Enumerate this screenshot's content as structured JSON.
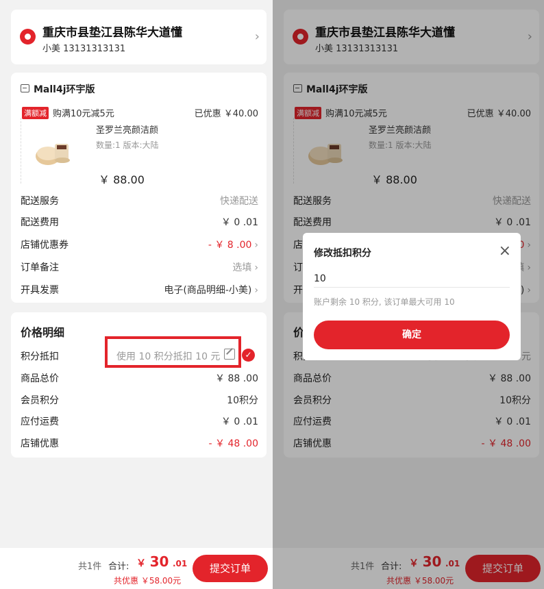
{
  "address": {
    "title": "重庆市县垫江县陈华大道懂",
    "contact": "小美 13131313131"
  },
  "shop": {
    "name": "Mall4j环宇版",
    "promo_tag": "满额减",
    "promo_text": "购满10元减5元",
    "promo_saved": "已优惠 ￥40.00",
    "product": {
      "name": "圣罗兰亮颜洁颜",
      "spec": "数量:1   版本:大陆",
      "price": "￥ 88.00"
    },
    "rows": [
      {
        "label": "配送服务",
        "value": "快递配送"
      },
      {
        "label": "配送费用",
        "value": "￥ 0 .01"
      },
      {
        "label": "店铺优惠券",
        "value": "- ￥ 8 .00"
      },
      {
        "label": "订单备注",
        "value": "选填"
      },
      {
        "label": "开具发票",
        "value": "电子(商品明细-小美)"
      }
    ]
  },
  "price_detail": {
    "title": "价格明细",
    "points": {
      "label": "积分抵扣",
      "value": "使用 10 积分抵扣 10 元"
    },
    "rows": [
      {
        "label": "商品总价",
        "value": "￥ 88 .00"
      },
      {
        "label": "会员积分",
        "value": "10积分"
      },
      {
        "label": "应付运费",
        "value": "￥ 0 .01"
      },
      {
        "label": "店铺优惠",
        "value": "- ￥ 48 .00"
      }
    ]
  },
  "footer": {
    "count": "共1件",
    "total_label": "合计:",
    "total_currency": "￥",
    "total_int": "30",
    "total_dec": ".01",
    "discount": "共优惠 ￥58.00元",
    "submit": "提交订单"
  },
  "dialog": {
    "title": "修改抵扣积分",
    "input_value": "10",
    "hint": "账户剩余 10 积分, 该订单最大可用 10",
    "confirm": "确定"
  },
  "colors": {
    "accent": "#e3242b"
  }
}
